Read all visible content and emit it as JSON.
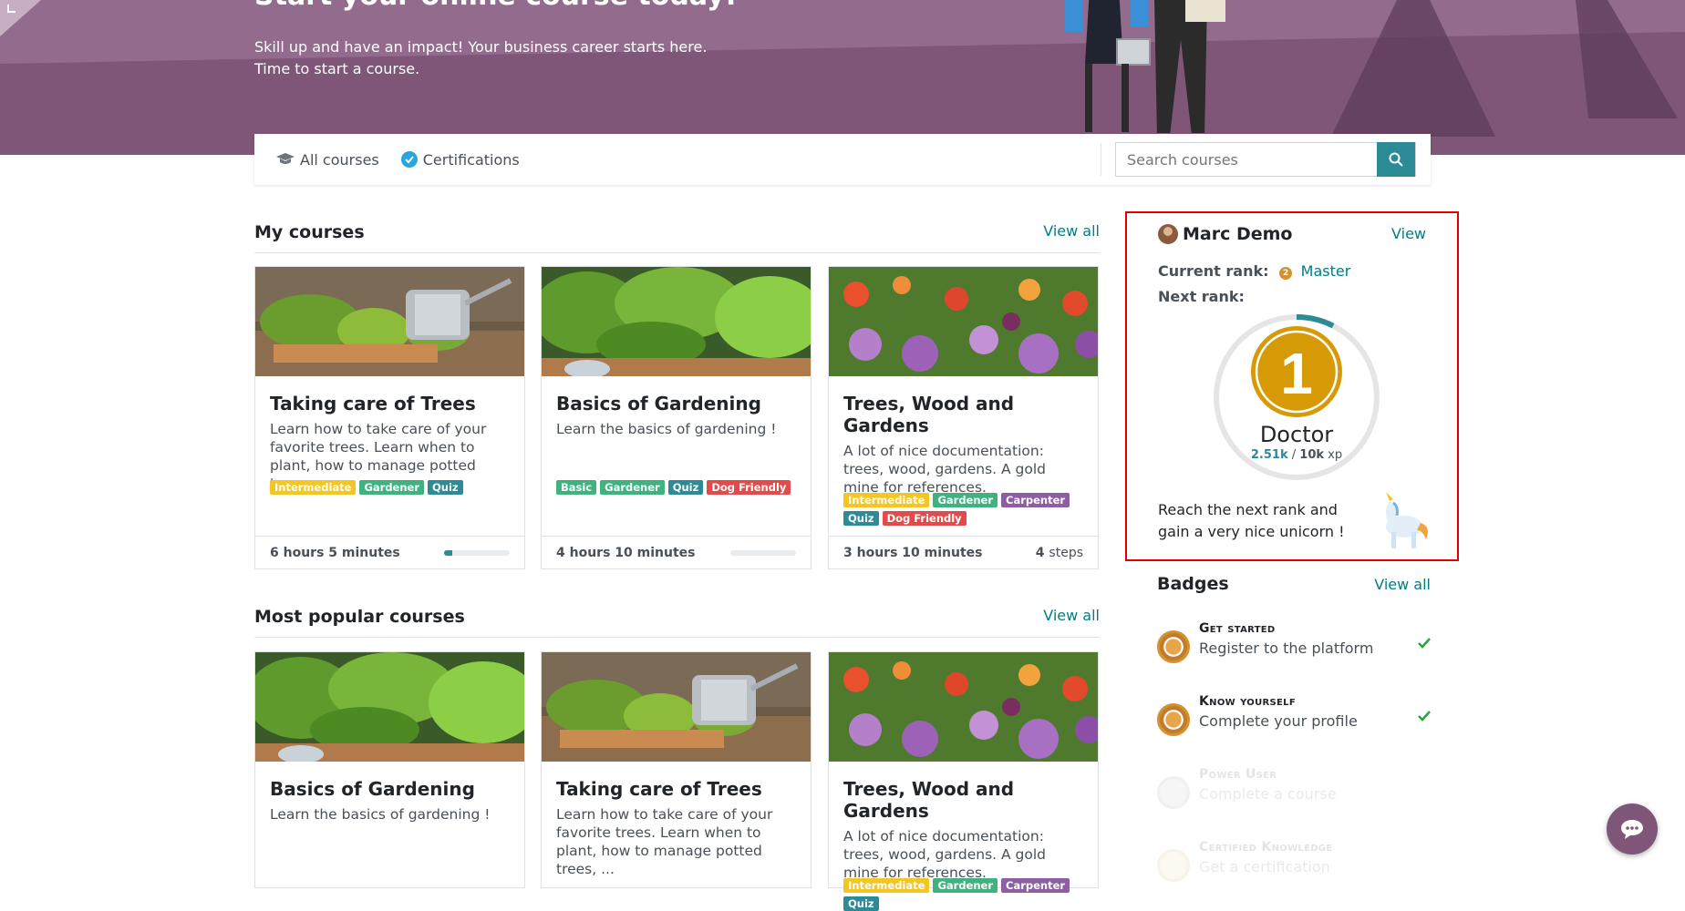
{
  "hero": {
    "title": "Start your online course today!",
    "line1": "Skill up and have an impact! Your business career starts here.",
    "line2": "Time to start a course."
  },
  "toolbar": {
    "all_courses": "All courses",
    "certifications": "Certifications",
    "search_placeholder": "Search courses"
  },
  "my_courses": {
    "title": "My courses",
    "view_all": "View all",
    "cards": [
      {
        "title": "Taking care of Trees",
        "desc": "Learn how to take care of your favorite trees. Learn when to plant, how to manage potted trees, ...",
        "tags": [
          "Intermediate",
          "Gardener",
          "Quiz"
        ],
        "duration": "6 hours 5 minutes",
        "progress": 0.12
      },
      {
        "title": "Basics of Gardening",
        "desc": "Learn the basics of gardening !",
        "tags": [
          "Basic",
          "Gardener",
          "Quiz",
          "Dog Friendly"
        ],
        "duration": "4 hours 10 minutes",
        "progress": 0
      },
      {
        "title": "Trees, Wood and Gardens",
        "desc": "A lot of nice documentation: trees, wood, gardens. A gold mine for references.",
        "tags": [
          "Intermediate",
          "Gardener",
          "Carpenter",
          "Quiz",
          "Dog Friendly"
        ],
        "duration": "3 hours 10 minutes",
        "steps_count": "4",
        "steps_label": "steps"
      }
    ]
  },
  "popular": {
    "title": "Most popular courses",
    "view_all": "View all",
    "cards": [
      {
        "title": "Basics of Gardening",
        "desc": "Learn the basics of gardening !"
      },
      {
        "title": "Taking care of Trees",
        "desc": "Learn how to take care of your favorite trees. Learn when to plant, how to manage potted trees, ..."
      },
      {
        "title": "Trees, Wood and Gardens",
        "desc": "A lot of nice documentation: trees, wood, gardens. A gold mine for references.",
        "tags": [
          "Intermediate",
          "Gardener",
          "Carpenter",
          "Quiz"
        ]
      }
    ]
  },
  "tag_colors": {
    "Intermediate": "#f3c623",
    "Gardener": "#3fb27f",
    "Quiz": "#2d8a97",
    "Basic": "#3fb27f",
    "Dog Friendly": "#e14b4b",
    "Carpenter": "#8e5ea2"
  },
  "user": {
    "name": "Marc Demo",
    "view": "View",
    "current_rank_label": "Current rank:",
    "current_rank_num": "2",
    "current_rank": "Master",
    "next_rank_label": "Next rank:",
    "next_rank_num": "1",
    "next_rank": "Doctor",
    "xp_current": "2.51k",
    "xp_sep": "/",
    "xp_target": "10k",
    "xp_unit": "xp",
    "xp_progress": 0.251,
    "reach": "Reach the next rank and gain a very nice unicorn !"
  },
  "badges": {
    "title": "Badges",
    "view_all": "View all",
    "items": [
      {
        "title": "Get started",
        "desc": "Register to the platform",
        "earned": true
      },
      {
        "title": "Know yourself",
        "desc": "Complete your profile",
        "earned": true
      },
      {
        "title": "Power User",
        "desc": "Complete a course",
        "earned": false
      },
      {
        "title": "Certified Knowledge",
        "desc": "Get a certification",
        "earned": false
      }
    ]
  },
  "colors": {
    "accent": "#017e84",
    "hero": "#7f5677",
    "highlight": "#e50000"
  }
}
